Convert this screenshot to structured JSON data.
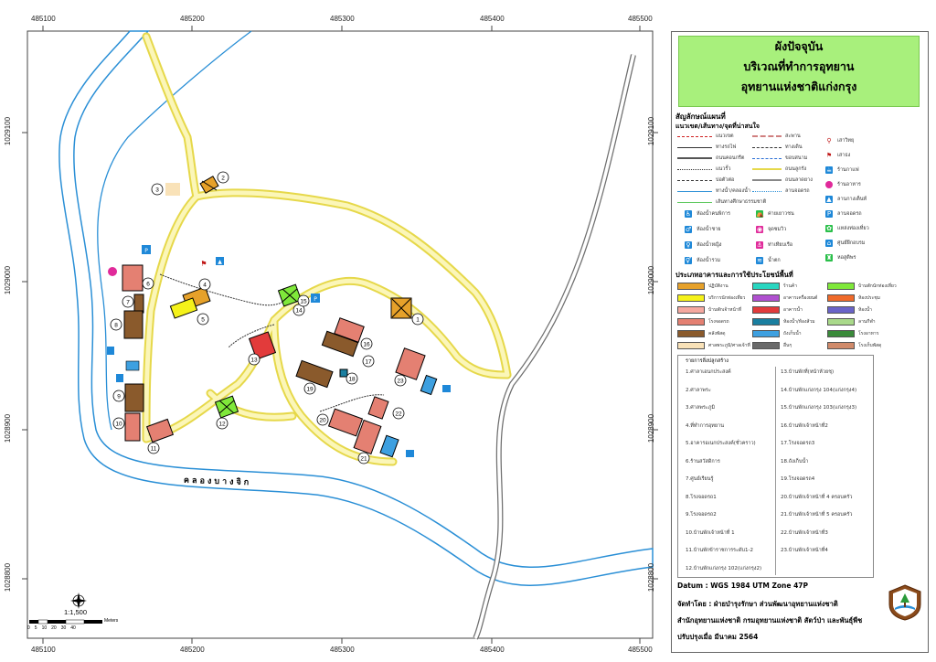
{
  "map": {
    "canal_label": "คลองบางจิก",
    "coords_top": [
      "485100",
      "485200",
      "485300",
      "485400",
      "485500"
    ],
    "coords_bottom": [
      "485100",
      "485200",
      "485300",
      "485400",
      "485500"
    ],
    "coords_left": [
      "1029100",
      "1029000",
      "1028900",
      "1028800"
    ],
    "coords_right": [
      "1029100",
      "1029000",
      "1028900",
      "1028800"
    ],
    "building_numbers": [
      "1",
      "2",
      "3",
      "4",
      "5",
      "6",
      "7",
      "8",
      "9",
      "10",
      "11",
      "12",
      "13",
      "14",
      "15",
      "16",
      "17",
      "18",
      "19",
      "20",
      "21",
      "22",
      "23"
    ],
    "colors": {
      "road": "#f7f29a",
      "road_edge": "#e6d84a",
      "river": "#2a8fd6",
      "river_fill": "#ffffff",
      "highway": "#6f6f6f"
    }
  },
  "legend": {
    "title_lines": [
      "ผังปัจจุบัน",
      "บริเวณที่ทำการอุทยาน",
      "อุทยานแห่งชาติแก่งกรุง"
    ],
    "symbols_title": "สัญลักษณ์แผนที่",
    "routes_title": "แนวเขต/เส้นทาง/จุดที่น่าสนใจ",
    "col1_lines": [
      "แนวเขต",
      "ทางรถไฟ",
      "ถนนคอนกรีต",
      "แนวรั้ว",
      "บ่อตัวต่อ",
      "ทางน้ำ/คลองน้ำ",
      "เส้นทางศึกษาธรรมชาติ"
    ],
    "col2_lines": [
      "สะพาน",
      "ทางเดิน",
      "ขอบสนาม",
      "ถนนลูกรัง",
      "ถนนลาดยาง",
      "ลานจอดรถ"
    ],
    "col3_icons": [
      "เสาวิทยุ",
      "เสาธง",
      "ร้านกาแฟ",
      "ร้านอาหาร",
      "ลานกางเต็นท์",
      "ลานจอดรถ",
      "แหล่งท่องเที่ยว",
      "ศูนย์ฝึกอบรม",
      "หอสูติพร"
    ],
    "poi_rows": [
      [
        "ห้องน้ำคนพิการ",
        "ค่ายเยาวชน"
      ],
      [
        "ห้องน้ำชาย",
        "จุดชมวิว"
      ],
      [
        "ห้องน้ำหญิง",
        "ท่าเทียบเรือ"
      ],
      [
        "ห้องน้ำรวม",
        "น้ำตก"
      ]
    ],
    "btype_title": "ประเภทอาคารและการใช้ประโยชน์พื้นที่",
    "btypes": [
      {
        "label": "ปฏิบัติงาน",
        "color": "#e6a12a"
      },
      {
        "label": "บริการนักท่องเที่ยว",
        "color": "#f5f21a"
      },
      {
        "label": "บ้านพักเจ้าหน้าที่",
        "color": "#f5a8a0"
      },
      {
        "label": "โรงจอดรถ",
        "color": "#e48072"
      },
      {
        "label": "คลังพัสดุ",
        "color": "#8a5a2c"
      },
      {
        "label": "ศาลพระภูมิ/ศาลเจ้าที่",
        "color": "#f9e2b8"
      },
      {
        "label": "ร้านค้า",
        "color": "#28d6c0"
      },
      {
        "label": "อาคารเครื่องยนต์",
        "color": "#b050d0"
      },
      {
        "label": "อาคารน้ำ",
        "color": "#e23b3b"
      },
      {
        "label": "ห้องน้ำ/ห้องส้วม",
        "color": "#1a7fa0"
      },
      {
        "label": "ถังเก็บน้ำ",
        "color": "#3ea0e0"
      },
      {
        "label": "อื่นๆ",
        "color": "#6a6a6a"
      },
      {
        "label": "บ้านพักนักท่องเที่ยว",
        "color": "#7fe83a"
      },
      {
        "label": "ห้องประชุม",
        "color": "#f06a2a"
      },
      {
        "label": "ห้องน้ำ",
        "color": "#6a64c8"
      },
      {
        "label": "ลานกีฬา",
        "color": "#a9d98a"
      },
      {
        "label": "โรงอาหาร",
        "color": "#3a8a3a"
      },
      {
        "label": "โรงเก็บพัสดุ",
        "color": "#d08a6a"
      }
    ],
    "building_list_title": "รายการสิ่งปลูกสร้าง",
    "building_list_col1": [
      "1.ศาลาเอนกประสงค์",
      "2.ศาลาพระ",
      "3.ศาลพระภูมิ",
      "4.ที่ทำการอุทยาน",
      "5.อาคารอเนกประสงค์(ชั่วคราว)",
      "6.ร้านสวัสดิการ",
      "7.ศูนย์เรียนรู้",
      "8.โรงจอดรถ1",
      "9.โรงจอดรถ2",
      "10.บ้านพักเจ้าหน้าที่ 1",
      "11.บ้านพักข้าราชการระดับ1-2",
      "12.บ้านพักแก่งกรุง 102(แก่งกรุง2)"
    ],
    "building_list_col2": [
      "13.บ้านพักที่(หน้าห้วยชุ)",
      "14.บ้านพักแก่งกรุง 104(แก่งกรุง4)",
      "15.บ้านพักแก่งกรุง 103(แก่งกรุง3)",
      "16.บ้านพักเจ้าหน้าที่2",
      "17.โรงจอดรถ3",
      "18.ถังเก็บน้ำ",
      "19.โรงจอดรถ4",
      "20.บ้านพักเจ้าหน้าที่ 4 ครอบครัว",
      "21.บ้านพักเจ้าหน้าที่ 5 ครอบครัว",
      "22.บ้านพักเจ้าหน้าที่3",
      "23.บ้านพักเจ้าหน้าที่4"
    ],
    "datum": "Datum  :  WGS 1984 UTM Zone 47P",
    "made_by_line1": "จัดทำโดย  :  ฝ่ายบำรุงรักษา ส่วนพัฒนาอุทยานแห่งชาติ",
    "made_by_line2": "สำนักอุทยานแห่งชาติ  กรมอุทยานแห่งชาติ สัตว์ป่า และพันธุ์พืช",
    "updated": "ปรับปรุงเมื่อ มีนาคม 2564"
  },
  "scale": {
    "ratio": "1:1,500",
    "ticks": [
      "0",
      "5",
      "10",
      "20",
      "30",
      "40"
    ],
    "unit": "Meters"
  }
}
